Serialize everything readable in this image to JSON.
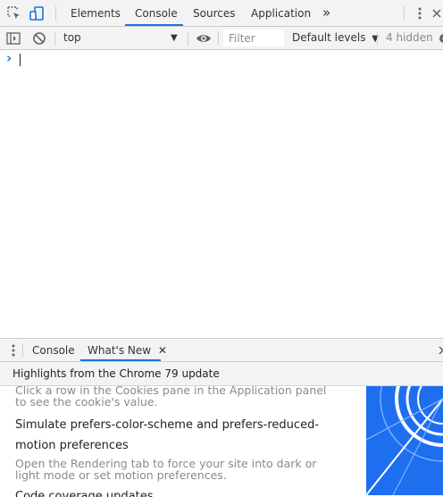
{
  "main_toolbar": {
    "tabs": [
      {
        "label": "Elements"
      },
      {
        "label": "Console",
        "active": true
      },
      {
        "label": "Sources"
      },
      {
        "label": "Application"
      }
    ],
    "overflow_glyph": "»",
    "icons": [
      "inspect-element-icon",
      "device-toolbar-icon",
      "more-tabs-icon",
      "kebab-menu-icon",
      "close-icon"
    ]
  },
  "console_toolbar": {
    "context": "top",
    "filter_placeholder": "Filter",
    "levels": "Default levels",
    "hidden_count": "4 hidden"
  },
  "console": {
    "prompt_glyph": "›"
  },
  "drawer": {
    "tabs": [
      {
        "label": "Console"
      },
      {
        "label": "What's New",
        "active": true
      }
    ],
    "header": "Highlights from the Chrome 79 update",
    "items": [
      {
        "desc": "Click a row in the Cookies pane in the Application panel to see the cookie's value."
      },
      {
        "title_line1": "Simulate prefers-color-scheme and prefers-reduced-",
        "title_line2": "motion preferences",
        "desc": "Open the Rendering tab to force your site into dark or light mode or set motion preferences."
      },
      {
        "title_line1": "Code coverage updates"
      }
    ]
  },
  "colors": {
    "accent": "#1a73e8",
    "toolbar_bg": "#f3f3f3",
    "promo_blue": "#1e6ff0"
  }
}
